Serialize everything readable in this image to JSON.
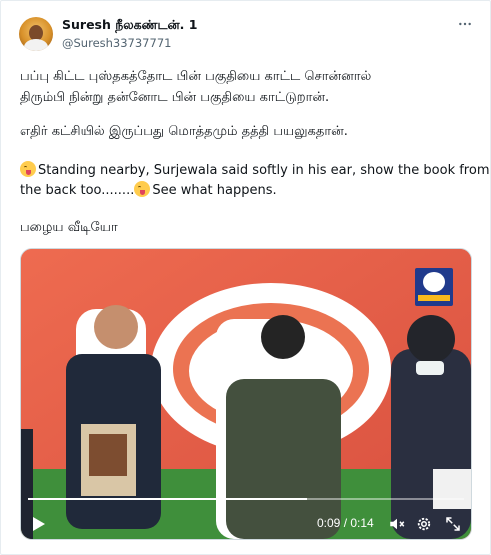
{
  "tweet": {
    "author_name": "Suresh நீலகண்டன். 1",
    "author_handle": "@Suresh33737771",
    "text_tamil_line1": "பப்பு கிட்ட புஸ்தகத்தோட பின் பகுதியை காட்ட சொன்னால்",
    "text_tamil_line2": "திரும்பி நின்று தன்னோட பின் பகுதியை காட்டுறான்.",
    "text_tamil_line3": "எதிர் கட்சியில் இருப்பது மொத்தமும் தத்தி பயலுகதான்.",
    "text_english_line1": "Standing nearby, Surjewala said softly in his ear, show the book from",
    "text_english_line2_before": "the back too........",
    "text_english_line2_after": "See what happens.",
    "text_tamil_footer": "பழைய வீடியோ"
  },
  "video": {
    "current_time": "0:09",
    "duration": "0:14",
    "time_separator": " / ",
    "progress_fraction": 0.64
  },
  "icons": {
    "more": "more-options-icon",
    "emoji": "winking-tongue-emoji-icon",
    "play": "play-icon",
    "volume": "volume-icon",
    "settings": "settings-gear-icon",
    "fullscreen": "fullscreen-icon"
  },
  "colors": {
    "text_primary": "#0f1419",
    "text_secondary": "#536471",
    "border": "#e6ecf0"
  }
}
